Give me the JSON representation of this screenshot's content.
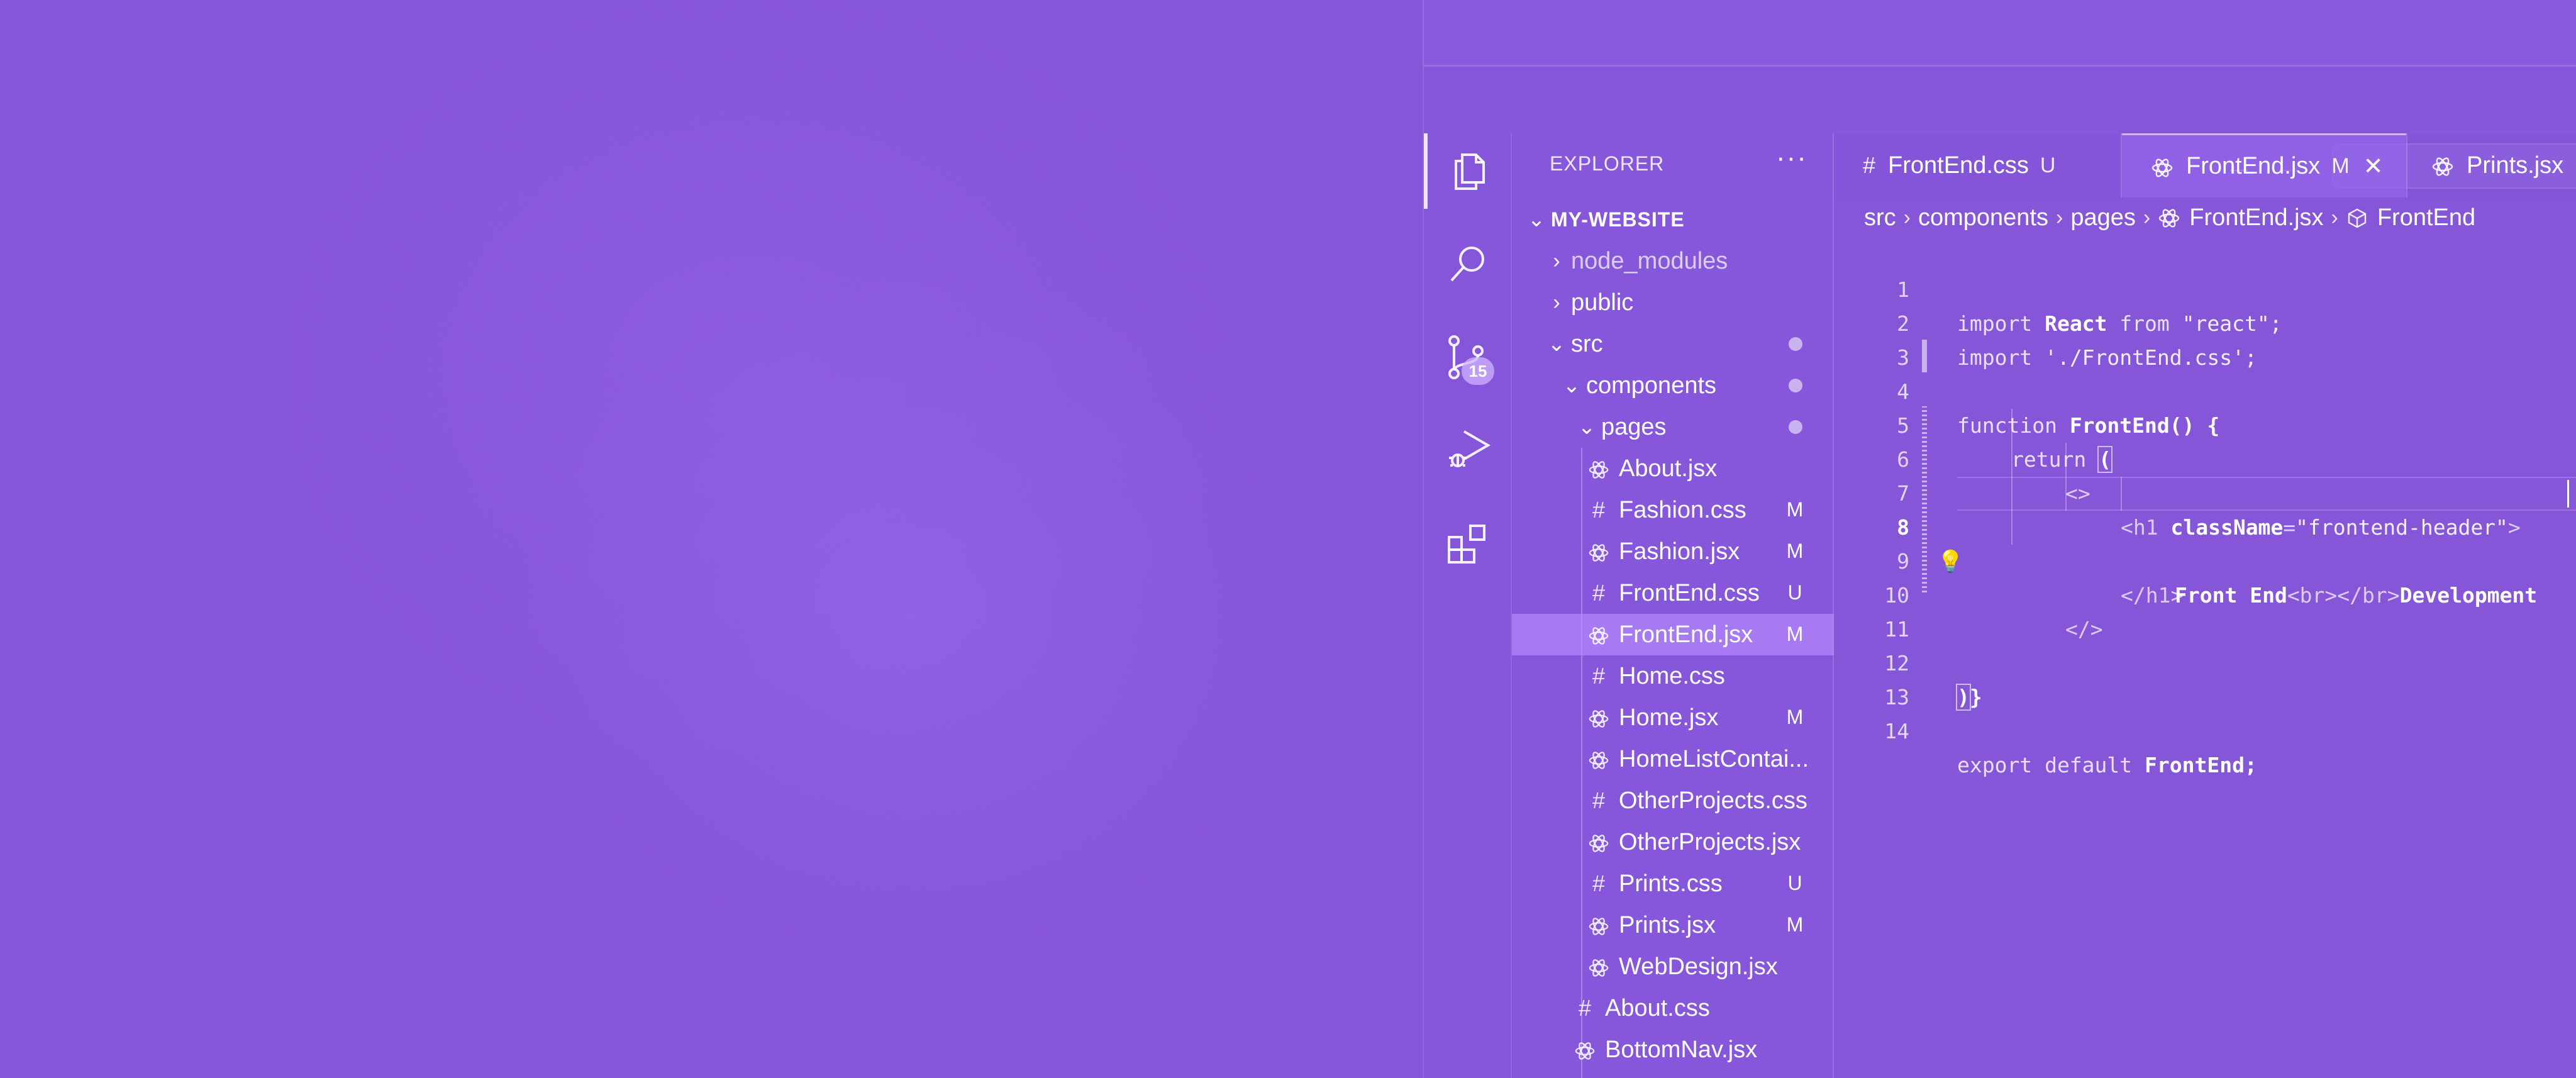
{
  "explorer": {
    "title": "EXPLORER",
    "more": "···",
    "root": "MY-WEBSITE",
    "items": [
      {
        "label": "node_modules",
        "kind": "folder",
        "open": false,
        "status": "",
        "dot": false
      },
      {
        "label": "public",
        "kind": "folder",
        "open": false,
        "status": "",
        "dot": false
      },
      {
        "label": "src",
        "kind": "folder",
        "open": true,
        "status": "",
        "dot": true
      },
      {
        "label": "components",
        "kind": "folder",
        "open": true,
        "status": "",
        "dot": true
      },
      {
        "label": "pages",
        "kind": "folder",
        "open": true,
        "status": "",
        "dot": true
      },
      {
        "label": "About.jsx",
        "kind": "jsx",
        "status": ""
      },
      {
        "label": "Fashion.css",
        "kind": "css",
        "status": "M"
      },
      {
        "label": "Fashion.jsx",
        "kind": "jsx",
        "status": "M"
      },
      {
        "label": "FrontEnd.css",
        "kind": "css",
        "status": "U"
      },
      {
        "label": "FrontEnd.jsx",
        "kind": "jsx",
        "status": "M",
        "selected": true
      },
      {
        "label": "Home.css",
        "kind": "css",
        "status": ""
      },
      {
        "label": "Home.jsx",
        "kind": "jsx",
        "status": "M"
      },
      {
        "label": "HomeListContai...",
        "kind": "jsx",
        "status": ""
      },
      {
        "label": "OtherProjects.css",
        "kind": "css",
        "status": ""
      },
      {
        "label": "OtherProjects.jsx",
        "kind": "jsx",
        "status": ""
      },
      {
        "label": "Prints.css",
        "kind": "css",
        "status": "U"
      },
      {
        "label": "Prints.jsx",
        "kind": "jsx",
        "status": "M"
      },
      {
        "label": "WebDesign.jsx",
        "kind": "jsx",
        "status": ""
      },
      {
        "label": "About.css",
        "kind": "css",
        "status": ""
      },
      {
        "label": "BottomNav.jsx",
        "kind": "jsx",
        "status": ""
      }
    ]
  },
  "activity": {
    "scm_badge": "15",
    "icons": [
      "files-icon",
      "search-icon",
      "source-control-icon",
      "run-debug-icon",
      "extensions-icon"
    ]
  },
  "tabs": [
    {
      "label": "FrontEnd.css",
      "kind": "css",
      "status": "U",
      "active": false
    },
    {
      "label": "FrontEnd.jsx",
      "kind": "jsx",
      "status": "M",
      "active": true,
      "close": "✕"
    },
    {
      "label": "Prints.jsx",
      "kind": "jsx",
      "status": "",
      "active": false
    }
  ],
  "breadcrumb": [
    "src",
    "components",
    "pages",
    "FrontEnd.jsx",
    "FrontEnd"
  ],
  "nav": {
    "back": "←",
    "forward": "→"
  },
  "code": {
    "current_line": 8,
    "lines": [
      {
        "n": "1"
      },
      {
        "n": "2"
      },
      {
        "n": "3"
      },
      {
        "n": "4"
      },
      {
        "n": "5"
      },
      {
        "n": "6"
      },
      {
        "n": "7"
      },
      {
        "n": "8"
      },
      {
        "n": "9"
      },
      {
        "n": "10"
      },
      {
        "n": "11"
      },
      {
        "n": "12"
      },
      {
        "n": "13"
      },
      {
        "n": "14"
      }
    ],
    "l1": {
      "a": "import ",
      "b": "React",
      "c": " from ",
      "d": "\"react\";"
    },
    "l2": {
      "a": "import ",
      "b": "'./FrontEnd.css';"
    },
    "l4": {
      "a": "function ",
      "b": "FrontEnd",
      "c": "() {"
    },
    "l5": {
      "a": "return ",
      "b": "("
    },
    "l6": {
      "a": "<>"
    },
    "l7": {
      "a": "<h1 ",
      "b": "className",
      "c": "=",
      "d": "\"frontend-header\"",
      "e": ">"
    },
    "l8": {
      "a": "Front End",
      "b": "<br></br>",
      "c": "Development"
    },
    "l9": {
      "a": "</h1>"
    },
    "l10": {
      "a": "</>"
    },
    "l12": {
      "a": ")",
      "b": "}"
    },
    "l14": {
      "a": "export default ",
      "b": "FrontEnd",
      "c": ";"
    }
  }
}
